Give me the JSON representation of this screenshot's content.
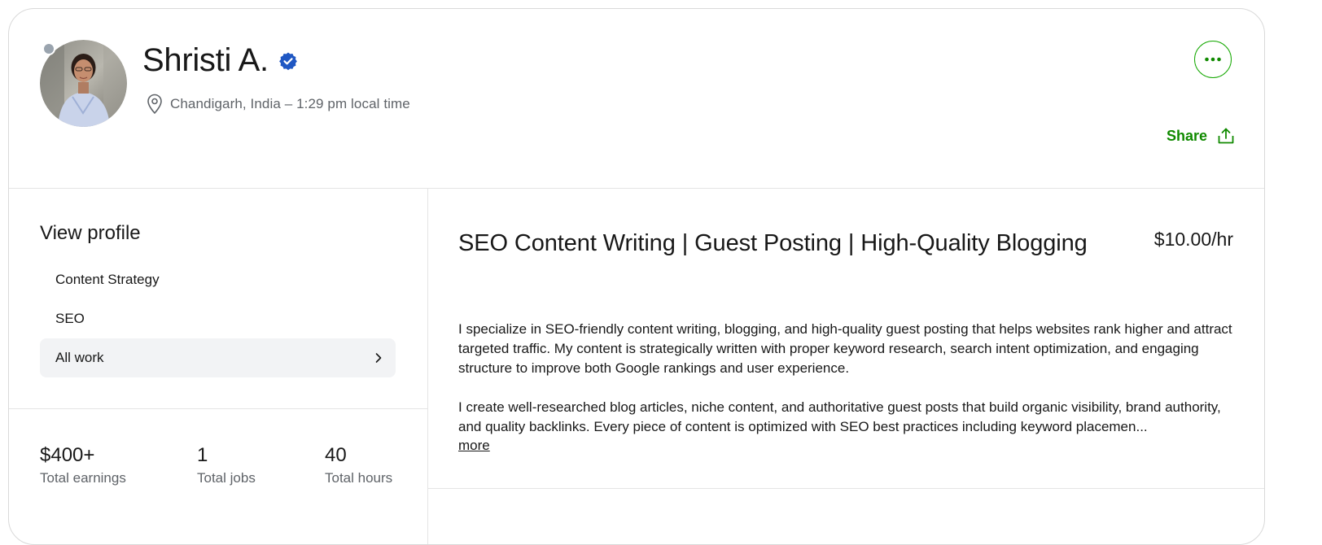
{
  "profile": {
    "name": "Shristi A.",
    "location": "Chandigarh, India – 1:29 pm local time",
    "verified": true,
    "status": "offline"
  },
  "actions": {
    "share_label": "Share",
    "more_icon": "more-horizontal-icon"
  },
  "sidebar": {
    "title": "View profile",
    "items": [
      {
        "label": "Content Strategy"
      },
      {
        "label": "SEO"
      },
      {
        "label": "All work"
      }
    ]
  },
  "stats": [
    {
      "value": "$400+",
      "label": "Total earnings"
    },
    {
      "value": "1",
      "label": "Total jobs"
    },
    {
      "value": "40",
      "label": "Total hours"
    }
  ],
  "main": {
    "title": "SEO Content Writing | Guest Posting | High-Quality Blogging",
    "rate": "$10.00/hr",
    "description": [
      "I specialize in SEO-friendly content writing, blogging, and high-quality guest posting that helps websites rank higher and attract targeted traffic. My content is strategically written with proper keyword research, search intent optimization, and engaging structure to improve both Google rankings and user experience.",
      "I create well-researched blog articles, niche content, and authoritative guest posts that build organic visibility, brand authority, and quality backlinks. Every piece of content is optimized with SEO best practices including keyword placemen..."
    ],
    "more_label": "more"
  },
  "colors": {
    "accent_green": "#14a800",
    "verified_blue": "#1f57c3",
    "muted_text": "#5f6368",
    "status_gray": "#9aa4ae"
  }
}
